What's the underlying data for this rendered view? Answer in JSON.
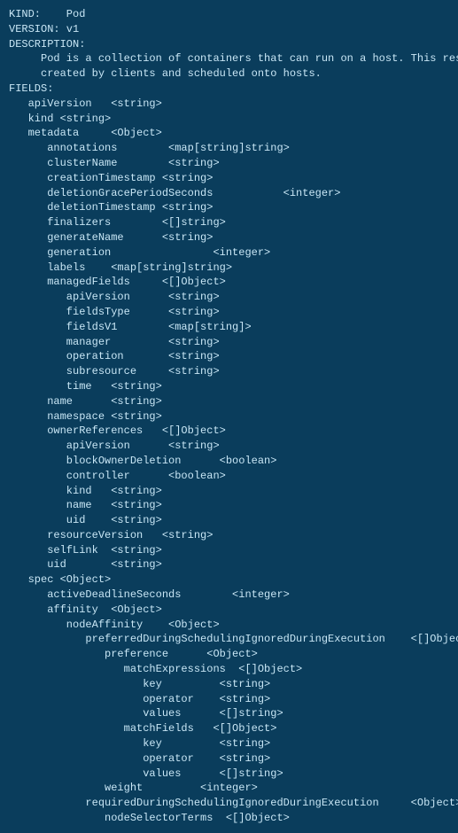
{
  "content": {
    "lines": [
      {
        "text": "KIND:    Pod",
        "indent": 0
      },
      {
        "text": "VERSION: v1",
        "indent": 0
      },
      {
        "text": "",
        "indent": 0
      },
      {
        "text": "DESCRIPTION:",
        "indent": 0
      },
      {
        "text": "     Pod is a collection of containers that can run on a host. This resource is",
        "indent": 0
      },
      {
        "text": "     created by clients and scheduled onto hosts.",
        "indent": 0
      },
      {
        "text": "",
        "indent": 0
      },
      {
        "text": "FIELDS:",
        "indent": 0
      },
      {
        "text": "   apiVersion   <string>",
        "indent": 0
      },
      {
        "text": "   kind <string>",
        "indent": 0
      },
      {
        "text": "   metadata     <Object>",
        "indent": 0
      },
      {
        "text": "      annotations        <map[string]string>",
        "indent": 0
      },
      {
        "text": "      clusterName        <string>",
        "indent": 0
      },
      {
        "text": "      creationTimestamp <string>",
        "indent": 0
      },
      {
        "text": "      deletionGracePeriodSeconds           <integer>",
        "indent": 0
      },
      {
        "text": "      deletionTimestamp <string>",
        "indent": 0
      },
      {
        "text": "      finalizers        <[]string>",
        "indent": 0
      },
      {
        "text": "      generateName      <string>",
        "indent": 0
      },
      {
        "text": "      generation                <integer>",
        "indent": 0
      },
      {
        "text": "      labels    <map[string]string>",
        "indent": 0
      },
      {
        "text": "      managedFields     <[]Object>",
        "indent": 0
      },
      {
        "text": "         apiVersion      <string>",
        "indent": 0
      },
      {
        "text": "         fieldsType      <string>",
        "indent": 0
      },
      {
        "text": "         fieldsV1        <map[string]>",
        "indent": 0
      },
      {
        "text": "         manager         <string>",
        "indent": 0
      },
      {
        "text": "         operation       <string>",
        "indent": 0
      },
      {
        "text": "         subresource     <string>",
        "indent": 0
      },
      {
        "text": "         time   <string>",
        "indent": 0
      },
      {
        "text": "      name      <string>",
        "indent": 0
      },
      {
        "text": "      namespace <string>",
        "indent": 0
      },
      {
        "text": "      ownerReferences   <[]Object>",
        "indent": 0
      },
      {
        "text": "         apiVersion      <string>",
        "indent": 0
      },
      {
        "text": "         blockOwnerDeletion      <boolean>",
        "indent": 0
      },
      {
        "text": "         controller      <boolean>",
        "indent": 0
      },
      {
        "text": "         kind   <string>",
        "indent": 0
      },
      {
        "text": "         name   <string>",
        "indent": 0
      },
      {
        "text": "         uid    <string>",
        "indent": 0
      },
      {
        "text": "      resourceVersion   <string>",
        "indent": 0
      },
      {
        "text": "      selfLink  <string>",
        "indent": 0
      },
      {
        "text": "      uid       <string>",
        "indent": 0
      },
      {
        "text": "   spec <Object>",
        "indent": 0
      },
      {
        "text": "      activeDeadlineSeconds        <integer>",
        "indent": 0
      },
      {
        "text": "      affinity  <Object>",
        "indent": 0
      },
      {
        "text": "         nodeAffinity    <Object>",
        "indent": 0
      },
      {
        "text": "            preferredDuringSchedulingIgnoredDuringExecution    <[]Object>",
        "indent": 0
      },
      {
        "text": "               preference      <Object>",
        "indent": 0
      },
      {
        "text": "                  matchExpressions  <[]Object>",
        "indent": 0
      },
      {
        "text": "                     key         <string>",
        "indent": 0
      },
      {
        "text": "                     operator    <string>",
        "indent": 0
      },
      {
        "text": "                     values      <[]string>",
        "indent": 0
      },
      {
        "text": "                  matchFields   <[]Object>",
        "indent": 0
      },
      {
        "text": "                     key         <string>",
        "indent": 0
      },
      {
        "text": "                     operator    <string>",
        "indent": 0
      },
      {
        "text": "                     values      <[]string>",
        "indent": 0
      },
      {
        "text": "               weight         <integer>",
        "indent": 0
      },
      {
        "text": "            requiredDuringSchedulingIgnoredDuringExecution     <Object>",
        "indent": 0
      },
      {
        "text": "               nodeSelectorTerms  <[]Object>",
        "indent": 0
      }
    ]
  }
}
